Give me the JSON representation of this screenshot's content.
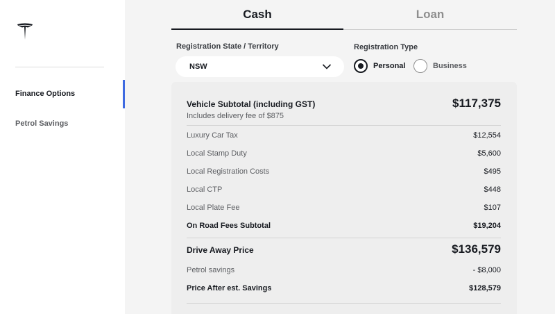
{
  "sidebar": {
    "logo_icon": "tesla-logo",
    "items": [
      {
        "label": "Finance Options",
        "active": true
      },
      {
        "label": "Petrol Savings",
        "active": false
      }
    ]
  },
  "tabs": [
    {
      "label": "Cash",
      "active": true
    },
    {
      "label": "Loan",
      "active": false
    }
  ],
  "registration": {
    "state_label": "Registration State / Territory",
    "state_value": "NSW",
    "type_label": "Registration Type",
    "options": [
      {
        "label": "Personal",
        "checked": true
      },
      {
        "label": "Business",
        "checked": false
      }
    ]
  },
  "summary": {
    "vehicle_subtotal_label": "Vehicle Subtotal (including GST)",
    "vehicle_subtotal_value": "$117,375",
    "delivery_note": "Includes delivery fee of $875",
    "fees": [
      {
        "label": "Luxury Car Tax",
        "value": "$12,554"
      },
      {
        "label": "Local Stamp Duty",
        "value": "$5,600"
      },
      {
        "label": "Local Registration Costs",
        "value": "$495"
      },
      {
        "label": "Local CTP",
        "value": "$448"
      },
      {
        "label": "Local Plate Fee",
        "value": "$107"
      }
    ],
    "on_road_label": "On Road Fees Subtotal",
    "on_road_value": "$19,204",
    "drive_away_label": "Drive Away Price",
    "drive_away_value": "$136,579",
    "petrol_label": "Petrol savings",
    "petrol_value": "- $8,000",
    "after_savings_label": "Price After est. Savings",
    "after_savings_value": "$128,579"
  },
  "colors": {
    "accent": "#3e6ae1",
    "text": "#171a20",
    "muted": "#5c5e62",
    "card_bg": "#eeeeee",
    "page_bg": "#f4f4f4"
  }
}
